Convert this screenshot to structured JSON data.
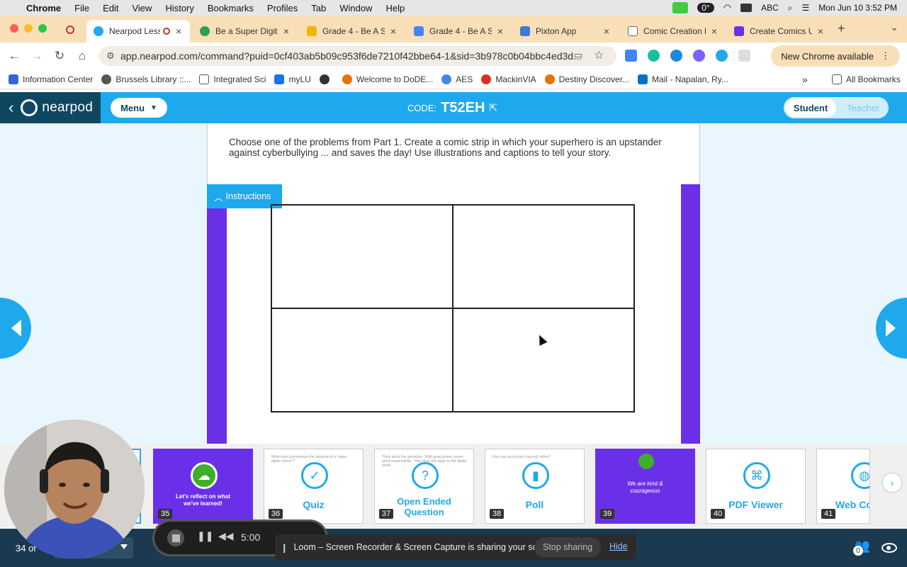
{
  "menubar": {
    "app": "Chrome",
    "items": [
      "File",
      "Edit",
      "View",
      "History",
      "Bookmarks",
      "Profiles",
      "Tab",
      "Window",
      "Help"
    ],
    "temp": "0°",
    "input_source": "ABC",
    "datetime": "Mon Jun 10  3:52 PM"
  },
  "tabs": [
    {
      "title": "Nearpod Less",
      "color": "#1fa9ed"
    },
    {
      "title": "Be a Super Digita",
      "color": "#2e9e4f"
    },
    {
      "title": "Grade 4 - Be A Su",
      "color": "#f4b400"
    },
    {
      "title": "Grade 4 - Be A Su",
      "color": "#4285f4"
    },
    {
      "title": "Pixton App",
      "color": "#3a7bd5"
    },
    {
      "title": "Comic Creation R",
      "color": "#666666"
    },
    {
      "title": "Create Comics U",
      "color": "#6a30e8"
    }
  ],
  "omnibox": {
    "url": "app.nearpod.com/command?puid=0cf403ab5b09c953f6de7210f42bbe64-1&sid=3b978c0b04bbc4ed3d..."
  },
  "new_chrome": "New Chrome available",
  "bookmarks": [
    {
      "label": "Information Center",
      "color": "#3367d6"
    },
    {
      "label": "Brussels Library ::...",
      "color": "#555555"
    },
    {
      "label": "Integrated Sci",
      "color": "#777777"
    },
    {
      "label": "myLU",
      "color": "#1a73e8"
    },
    {
      "label": "",
      "color": "#333333"
    },
    {
      "label": "Welcome to DoDE...",
      "color": "#e8710a"
    },
    {
      "label": "AES",
      "color": "#4285f4"
    },
    {
      "label": "MackinVIA",
      "color": "#d93025"
    },
    {
      "label": "Destiny Discover...",
      "color": "#e37400"
    },
    {
      "label": "Mail - Napalan, Ry...",
      "color": "#0072c6"
    }
  ],
  "all_bookmarks": "All Bookmarks",
  "nearpod": {
    "logo": "nearpod",
    "menu": "Menu",
    "code_label": "CODE:",
    "code_value": "T52EH",
    "role_student": "Student",
    "role_teacher": "Teacher",
    "prompt": "Choose one of the problems from Part 1. Create a comic strip in which your superhero is an upstander against cyberbullying ... and saves the day!  Use illustrations and captions to tell your story.",
    "instructions": "Instructions"
  },
  "slides": [
    {
      "num": "35",
      "label": "Let's reflect on what we've learned!",
      "kind": "purple"
    },
    {
      "num": "36",
      "label": "Quiz",
      "kind": "white",
      "sub": "What word summarizes the behavior of a \"super digital citizen\"?"
    },
    {
      "num": "37",
      "label": "Open Ended Question",
      "kind": "white",
      "sub": "Think about the quotation: \"With great power comes great responsibility.\" How does this apply to the digital world..."
    },
    {
      "num": "38",
      "label": "Poll",
      "kind": "white",
      "sub": "How can you protect yourself online?"
    },
    {
      "num": "39",
      "label": "We are kind & courageous",
      "kind": "purple"
    },
    {
      "num": "40",
      "label": "PDF Viewer",
      "kind": "white",
      "sub": ""
    },
    {
      "num": "41",
      "label": "Web Co",
      "kind": "white",
      "sub": ""
    }
  ],
  "bottom": {
    "page": "34 of",
    "participants": "0"
  },
  "loom": {
    "time": "5:00"
  },
  "share_bar": {
    "text": "Loom – Screen Recorder & Screen Capture is sharing your screen.",
    "stop": "Stop sharing",
    "hide": "Hide"
  }
}
